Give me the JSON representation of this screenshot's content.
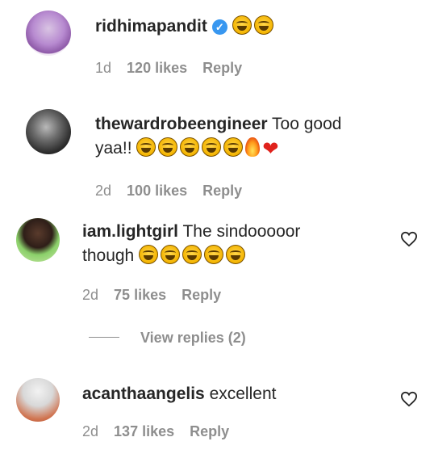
{
  "comments": [
    {
      "username": "ridhimapandit",
      "text": "",
      "emojis": [
        "face-with-tears-of-joy",
        "face-with-tears-of-joy"
      ],
      "verified": true,
      "time": "1d",
      "likes": "120 likes",
      "reply": "Reply"
    },
    {
      "username": "thewardrobeengineer",
      "text_line1": "Too good",
      "text_line2": "yaa!!",
      "emojis": [
        "face-with-tears-of-joy",
        "face-with-tears-of-joy",
        "face-with-tears-of-joy",
        "face-with-tears-of-joy",
        "face-with-tears-of-joy",
        "fire",
        "red-heart"
      ],
      "time": "2d",
      "likes": "100 likes",
      "reply": "Reply"
    },
    {
      "username": "iam.lightgirl",
      "text_line1": "The sindooooor",
      "text_line2": "though",
      "emojis": [
        "face-with-tears-of-joy",
        "face-with-tears-of-joy",
        "face-with-tears-of-joy",
        "face-with-tears-of-joy",
        "face-with-tears-of-joy"
      ],
      "time": "2d",
      "likes": "75 likes",
      "reply": "Reply",
      "view_replies": "View replies (2)"
    },
    {
      "username": "acanthaangelis",
      "text": "excellent",
      "time": "2d",
      "likes": "137 likes",
      "reply": "Reply"
    }
  ],
  "colors": {
    "text": "#262626",
    "meta": "#8e8e8e",
    "verified": "#3897f0"
  }
}
